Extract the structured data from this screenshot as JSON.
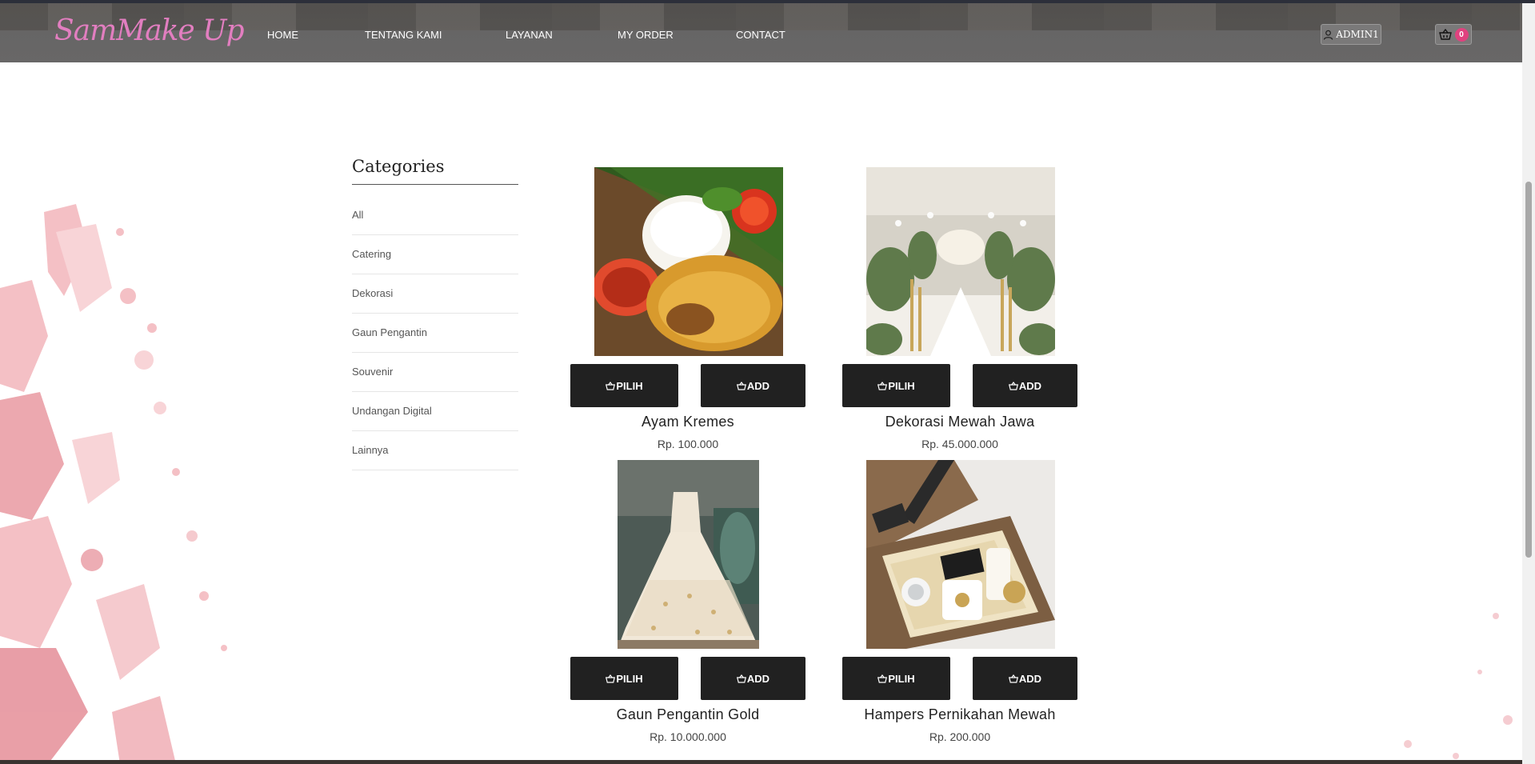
{
  "brand": {
    "logo_text": "SamMake Up",
    "accent": "#e27ec0"
  },
  "nav": {
    "items": [
      {
        "label": "HOME"
      },
      {
        "label": "TENTANG KAMI"
      },
      {
        "label": "LAYANAN"
      },
      {
        "label": "MY ORDER"
      },
      {
        "label": "CONTACT"
      }
    ]
  },
  "header": {
    "user_label": "ADMIN1",
    "user_icon": "user-icon",
    "cart_icon": "basket-icon",
    "cart_count": "0"
  },
  "sidebar": {
    "title": "Categories",
    "categories": [
      {
        "label": "All"
      },
      {
        "label": "Catering"
      },
      {
        "label": "Dekorasi"
      },
      {
        "label": "Gaun Pengantin"
      },
      {
        "label": "Souvenir"
      },
      {
        "label": "Undangan Digital"
      },
      {
        "label": "Lainnya"
      }
    ]
  },
  "products": [
    {
      "name": "Ayam Kremes",
      "price": "Rp. 100.000",
      "select_label": "PILIH",
      "add_label": "ADD",
      "image": "fried-chicken-rice-photo"
    },
    {
      "name": "Dekorasi Mewah Jawa",
      "price": "Rp. 45.000.000",
      "select_label": "PILIH",
      "add_label": "ADD",
      "image": "wedding-decoration-photo"
    },
    {
      "name": "Gaun Pengantin Gold",
      "price": "Rp. 10.000.000",
      "select_label": "PILIH",
      "add_label": "ADD",
      "image": "wedding-gown-photo"
    },
    {
      "name": "Hampers Pernikahan Mewah",
      "price": "Rp. 200.000",
      "select_label": "PILIH",
      "add_label": "ADD",
      "image": "wedding-hampers-photo"
    }
  ],
  "colors": {
    "button_bg": "#212121",
    "badge": "#e0427f",
    "header_bg": "#666565"
  }
}
